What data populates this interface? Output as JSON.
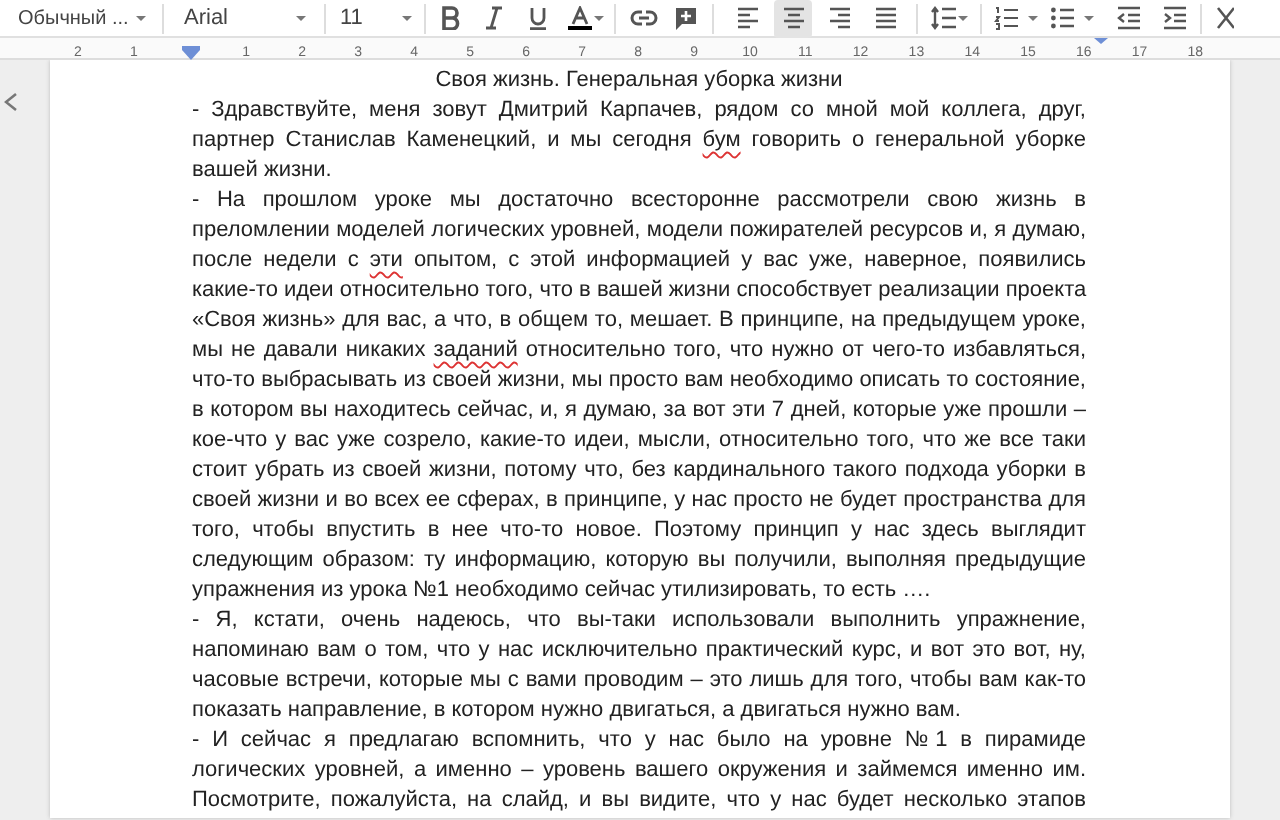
{
  "toolbar": {
    "style": "Обычный ...",
    "font": "Arial",
    "size": "11",
    "alignment": [
      {
        "kind": "left",
        "selected": false
      },
      {
        "kind": "center",
        "selected": true
      },
      {
        "kind": "right",
        "selected": false
      },
      {
        "kind": "justify",
        "selected": false
      }
    ]
  },
  "ruler": {
    "labels": [
      "2",
      "1",
      "1",
      "2",
      "3",
      "4",
      "5",
      "6",
      "7",
      "8",
      "9",
      "10",
      "11",
      "12",
      "13",
      "14",
      "15",
      "16",
      "17",
      "18"
    ]
  },
  "document": {
    "title": "Своя жизнь. Генеральная уборка жизни",
    "paragraphs": [
      {
        "continues": false,
        "lines": [
          [
            {
              "text": "- Здравствуйте, меня зовут Дмитрий Карпачев, рядом со мной мой коллега, друг,",
              "misspelled": false
            }
          ],
          [
            {
              "text": "партнер Станислав Каменецкий, и мы сегодня ",
              "misspelled": false
            },
            {
              "text": "бум",
              "misspelled": true
            },
            {
              "text": " говорить о генеральной уборке",
              "misspelled": false
            }
          ],
          [
            {
              "text": "вашей жизни.",
              "misspelled": false
            }
          ]
        ]
      },
      {
        "continues": false,
        "lines": [
          [
            {
              "text": "- На прошлом уроке мы достаточно всесторонне рассмотрели свою жизнь в",
              "misspelled": false
            }
          ],
          [
            {
              "text": "преломлении моделей логических уровней, модели пожирателей ресурсов и, я думаю,",
              "misspelled": false
            }
          ],
          [
            {
              "text": "после недели с ",
              "misspelled": false
            },
            {
              "text": "эти",
              "misspelled": true
            },
            {
              "text": " опытом, с этой информацией у вас уже, наверное, появились",
              "misspelled": false
            }
          ],
          [
            {
              "text": "какие-то идеи относительно того, что в вашей жизни способствует реализации проекта",
              "misspelled": false
            }
          ],
          [
            {
              "text": "«Своя жизнь» для вас, а что, в общем то, мешает. В принципе, на предыдущем уроке,",
              "misspelled": false
            }
          ],
          [
            {
              "text": "мы не давали никаких ",
              "misspelled": false
            },
            {
              "text": "заданий",
              "misspelled": true
            },
            {
              "text": " относительно того, что нужно от чего-то избавляться,",
              "misspelled": false
            }
          ],
          [
            {
              "text": "что-то выбрасывать из своей жизни, мы просто вам необходимо описать то состояние,",
              "misspelled": false
            }
          ],
          [
            {
              "text": "в котором вы находитесь сейчас, и, я думаю, за вот эти 7 дней, которые уже прошли –",
              "misspelled": false
            }
          ],
          [
            {
              "text": "кое-что у вас уже созрело, какие-то идеи, мысли, относительно того, что же все таки",
              "misspelled": false
            }
          ],
          [
            {
              "text": "стоит убрать из своей жизни, потому что, без кардинального такого подхода уборки в",
              "misspelled": false
            }
          ],
          [
            {
              "text": "своей жизни и во всех ее сферах, в принципе, у нас просто не будет пространства для",
              "misspelled": false
            }
          ],
          [
            {
              "text": "того, чтобы впустить в нее что-то новое. Поэтому принцип у нас здесь выглядит",
              "misspelled": false
            }
          ],
          [
            {
              "text": "следующим образом: ту информацию, которую вы получили, выполняя предыдущие",
              "misspelled": false
            }
          ],
          [
            {
              "text": "упражнения из урока №1 необходимо сейчас утилизировать, то есть ….",
              "misspelled": false
            }
          ]
        ]
      },
      {
        "continues": false,
        "lines": [
          [
            {
              "text": "- Я, кстати, очень надеюсь, что вы-таки использовали выполнить упражнение,",
              "misspelled": false
            }
          ],
          [
            {
              "text": "напоминаю вам о том, что у нас исключительно практический курс, и вот это вот, ну,",
              "misspelled": false
            }
          ],
          [
            {
              "text": "часовые встречи, которые мы с вами проводим – это лишь для того, чтобы вам как-то",
              "misspelled": false
            }
          ],
          [
            {
              "text": "показать направление, в котором нужно двигаться, а двигаться нужно вам.",
              "misspelled": false
            }
          ]
        ]
      },
      {
        "continues": true,
        "lines": [
          [
            {
              "text": "- И сейчас я предлагаю вспомнить, что у нас было на уровне №1 в пирамиде",
              "misspelled": false
            }
          ],
          [
            {
              "text": "логических уровней, а именно – уровень вашего окружения и займемся именно им.",
              "misspelled": false
            }
          ],
          [
            {
              "text": "Посмотрите, пожалуйста, на слайд, и вы видите, что у нас будет несколько этапов",
              "misspelled": false
            }
          ]
        ]
      }
    ]
  }
}
